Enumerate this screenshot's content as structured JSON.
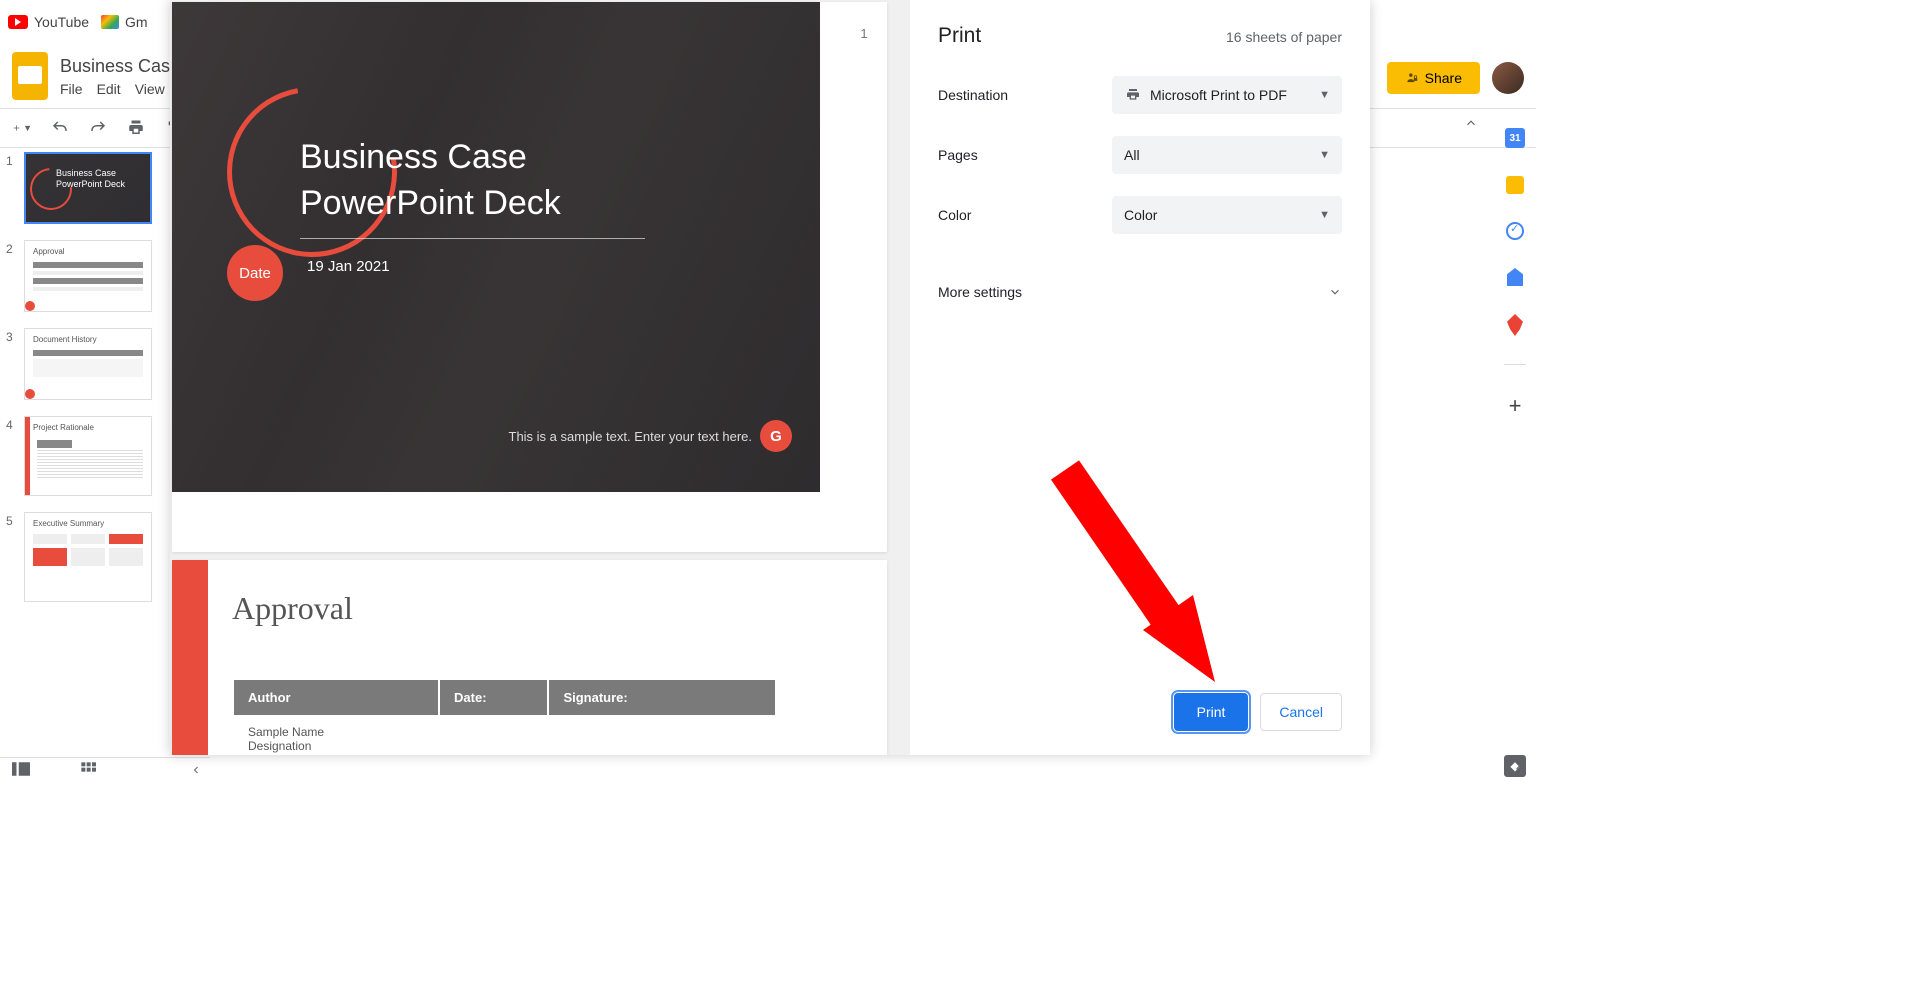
{
  "browser": {
    "tab1": "YouTube",
    "tab2": "Gm"
  },
  "slides": {
    "doc_title": "Business Cas",
    "menu": {
      "file": "File",
      "edit": "Edit",
      "view": "View"
    },
    "share_label": "Share"
  },
  "thumbs": {
    "n1": "1",
    "n2": "2",
    "n3": "3",
    "n4": "4",
    "n5": "5",
    "t1_l1": "Business Case",
    "t1_l2": "PowerPoint Deck",
    "t2_title": "Approval",
    "t3_title": "Document History",
    "t4_title": "Project Rationale",
    "t5_title": "Executive Summary"
  },
  "preview": {
    "page1_num": "1",
    "s1_title_l1": "Business Case",
    "s1_title_l2": "PowerPoint Deck",
    "s1_date_label": "Date",
    "s1_date_value": "19 Jan 2021",
    "s1_footer": "This is a sample text. Enter your text here.",
    "s1_badge": "G",
    "s2_title": "Approval",
    "s2_th_author": "Author",
    "s2_th_date": "Date:",
    "s2_th_sig": "Signature:",
    "s2_td_name": "Sample Name",
    "s2_td_desig": "Designation"
  },
  "print": {
    "title": "Print",
    "sheets": "16 sheets of paper",
    "destination_label": "Destination",
    "destination_value": "Microsoft Print to PDF",
    "pages_label": "Pages",
    "pages_value": "All",
    "color_label": "Color",
    "color_value": "Color",
    "more_label": "More settings",
    "print_btn": "Print",
    "cancel_btn": "Cancel"
  },
  "side": {
    "cal": "31"
  }
}
